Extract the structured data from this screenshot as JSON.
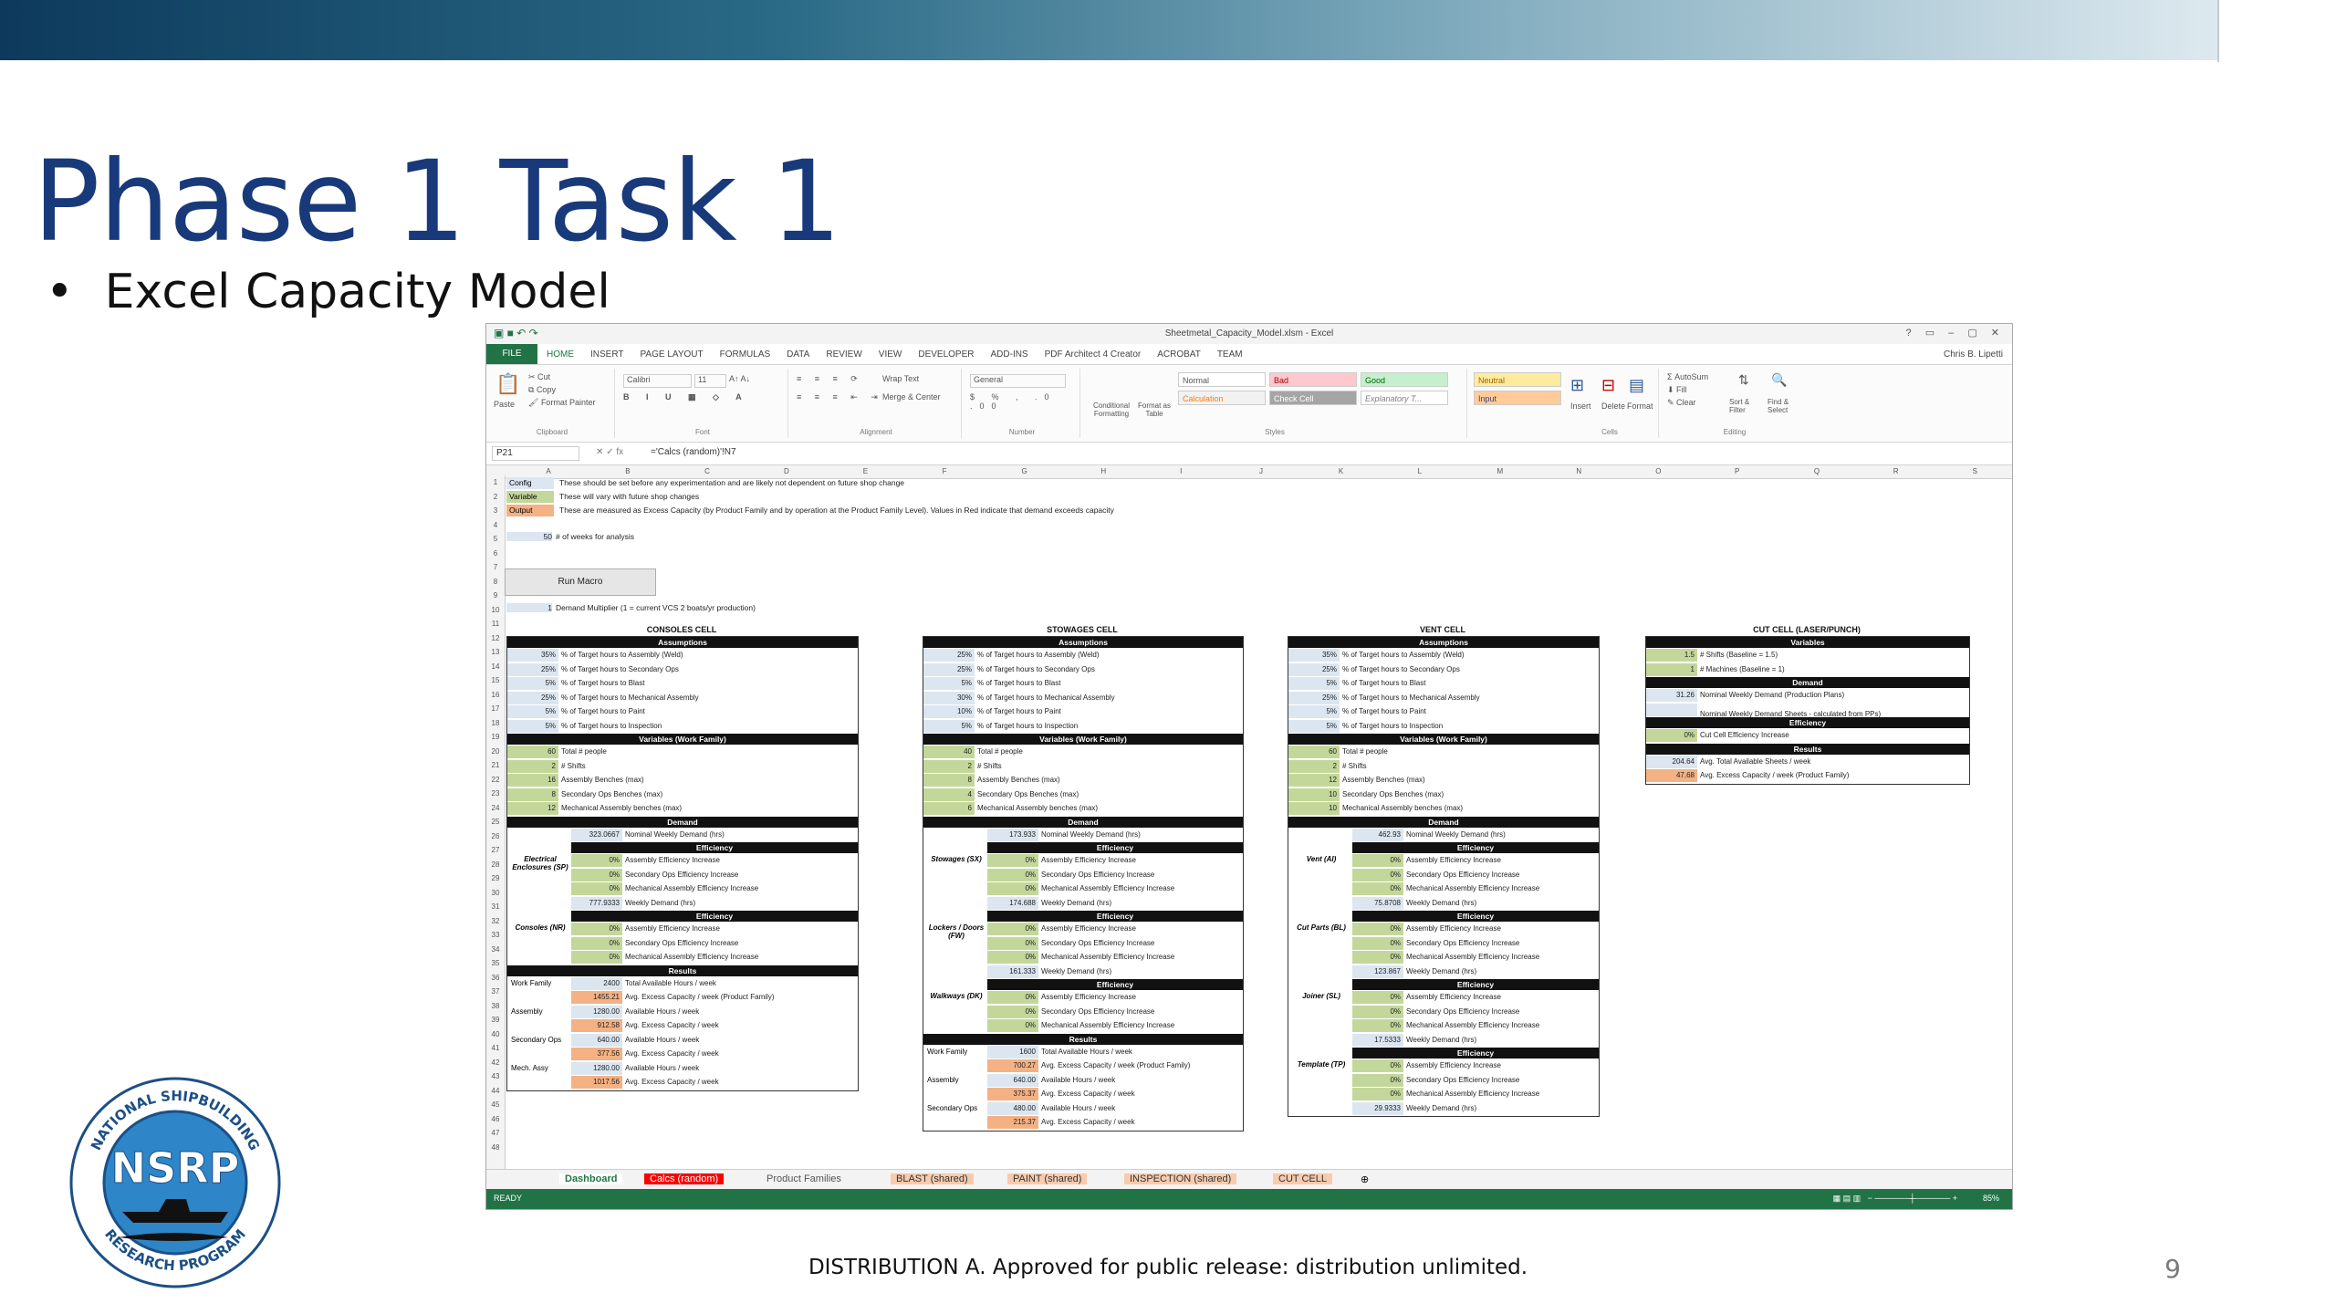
{
  "slide": {
    "title": "Phase 1 Task 1",
    "bullet": "Excel Capacity Model",
    "footer": "DISTRIBUTION A.  Approved for public release: distribution unlimited.",
    "page_number": "9",
    "logo": {
      "text": "NSRP",
      "ring_top": "NATIONAL    SHIPBUILDING",
      "ring_bottom": "RESEARCH    PROGRAM"
    }
  },
  "excel": {
    "window_title": "Sheetmetal_Capacity_Model.xlsm - Excel",
    "ribbon_tabs": [
      "FILE",
      "HOME",
      "INSERT",
      "PAGE LAYOUT",
      "FORMULAS",
      "DATA",
      "REVIEW",
      "VIEW",
      "DEVELOPER",
      "ADD-INS",
      "PDF Architect 4 Creator",
      "ACROBAT",
      "TEAM"
    ],
    "user": "Chris B. Lipetti",
    "clipboard": {
      "paste": "Paste",
      "cut": "Cut",
      "copy": "Copy",
      "format_painter": "Format Painter",
      "caption": "Clipboard"
    },
    "font": {
      "name": "Calibri",
      "size": "11",
      "caption": "Font"
    },
    "alignment": {
      "wrap": "Wrap Text",
      "merge": "Merge & Center",
      "caption": "Alignment"
    },
    "number": {
      "format": "General",
      "caption": "Number"
    },
    "styles": {
      "conditional": "Conditional Formatting",
      "format_table": "Format as Table",
      "normal": "Normal",
      "bad": "Bad",
      "good": "Good",
      "neutral": "Neutral",
      "calculation": "Calculation",
      "check_cell": "Check Cell",
      "explanatory": "Explanatory T...",
      "input": "Input",
      "caption": "Styles"
    },
    "cells": {
      "insert": "Insert",
      "delete": "Delete",
      "format": "Format",
      "caption": "Cells"
    },
    "editing": {
      "autosum": "AutoSum",
      "fill": "Fill",
      "clear": "Clear",
      "sort": "Sort & Filter",
      "find": "Find & Select",
      "caption": "Editing"
    },
    "name_box": "P21",
    "formula": "='Calcs (random)'!N7",
    "columns": [
      "A",
      "B",
      "C",
      "D",
      "E",
      "F",
      "G",
      "H",
      "I",
      "J",
      "K",
      "L",
      "M",
      "N",
      "O",
      "P",
      "Q",
      "R",
      "S"
    ],
    "legend": [
      {
        "tag": "Config",
        "desc": "These should be set before any experimentation and are likely not dependent on future shop change"
      },
      {
        "tag": "Variable",
        "desc": "These will vary with future shop changes"
      },
      {
        "tag": "Output",
        "desc": "These are measured as Excess Capacity (by Product Family and by operation at the Product Family Level).  Values in Red indicate that demand exceeds capacity"
      }
    ],
    "weeks": {
      "value": "50",
      "label": "# of weeks for analysis"
    },
    "run_macro": "Run Macro",
    "demand_multiplier": {
      "value": "1",
      "label": "Demand Multiplier (1 = current VCS 2 boats/yr production)"
    },
    "consoles": {
      "title": "CONSOLES CELL",
      "assumptions": "Assumptions",
      "rows": [
        [
          "35%",
          "% of Target hours to Assembly (Weld)"
        ],
        [
          "25%",
          "% of Target hours to Secondary Ops"
        ],
        [
          "5%",
          "% of Target hours to Blast"
        ],
        [
          "25%",
          "% of Target hours to Mechanical Assembly"
        ],
        [
          "5%",
          "% of Target hours to Paint"
        ],
        [
          "5%",
          "% of Target hours to Inspection"
        ]
      ],
      "variables": "Variables (Work Family)",
      "vrows": [
        [
          "60",
          "Total # people"
        ],
        [
          "2",
          "# Shifts"
        ],
        [
          "16",
          "Assembly Benches (max)"
        ],
        [
          "8",
          "Secondary Ops Benches (max)"
        ],
        [
          "12",
          "Mechanical Assembly benches (max)"
        ]
      ],
      "demand": "Demand",
      "nominal": [
        "323.0667",
        "Nominal Weekly Demand (hrs)"
      ],
      "efficiency": "Efficiency",
      "erows": [
        [
          "0%",
          "Assembly Efficiency Increase"
        ],
        [
          "0%",
          "Secondary Ops Efficiency Increase"
        ],
        [
          "0%",
          "Mechanical Assembly Efficiency Increase"
        ]
      ],
      "family_a": "Electrical Enclosures (SP)",
      "weekly_a": [
        "777.9333",
        "Weekly Demand (hrs)"
      ],
      "efficiency_b": "Efficiency",
      "erows_b": [
        [
          "0%",
          "Assembly Efficiency Increase"
        ],
        [
          "0%",
          "Secondary Ops Efficiency Increase"
        ],
        [
          "0%",
          "Mechanical Assembly Efficiency Increase"
        ]
      ],
      "family_b": "Consoles (NR)",
      "results": "Results",
      "res": [
        [
          "Work Family",
          "2400",
          "Total Available Hours / week"
        ],
        [
          "",
          "1455.21",
          "Avg. Excess Capacity / week (Product Family)"
        ],
        [
          "Assembly",
          "1280.00",
          "Available Hours / week"
        ],
        [
          "",
          "912.58",
          "Avg. Excess Capacity / week"
        ],
        [
          "Secondary Ops",
          "640.00",
          "Available Hours / week"
        ],
        [
          "",
          "377.56",
          "Avg. Excess Capacity / week"
        ],
        [
          "Mech. Assy",
          "1280.00",
          "Available Hours / week"
        ],
        [
          "",
          "1017.56",
          "Avg. Excess Capacity / week"
        ]
      ]
    },
    "stowages": {
      "title": "STOWAGES CELL",
      "assumptions": "Assumptions",
      "rows": [
        [
          "25%",
          "% of Target hours to Assembly (Weld)"
        ],
        [
          "25%",
          "% of Target hours to Secondary Ops"
        ],
        [
          "5%",
          "% of Target hours to Blast"
        ],
        [
          "30%",
          "% of Target hours to Mechanical Assembly"
        ],
        [
          "10%",
          "% of Target hours to Paint"
        ],
        [
          "5%",
          "% of Target hours to Inspection"
        ]
      ],
      "variables": "Variables (Work Family)",
      "vrows": [
        [
          "40",
          "Total # people"
        ],
        [
          "2",
          "# Shifts"
        ],
        [
          "8",
          "Assembly Benches (max)"
        ],
        [
          "4",
          "Secondary Ops Benches (max)"
        ],
        [
          "6",
          "Mechanical Assembly benches (max)"
        ]
      ],
      "demand": "Demand",
      "nominal": [
        "173.933",
        "Nominal Weekly Demand (hrs)"
      ],
      "efficiency": "Efficiency",
      "family_a": "Stowages (SX)",
      "erows": [
        [
          "0%",
          "Assembly Efficiency Increase"
        ],
        [
          "0%",
          "Secondary Ops Efficiency Increase"
        ],
        [
          "0%",
          "Mechanical Assembly Efficiency Increase"
        ]
      ],
      "weekly_a": [
        "174.688",
        "Weekly Demand (hrs)"
      ],
      "family_b": "Lockers / Doors (FW)",
      "erows_b": [
        [
          "0%",
          "Assembly Efficiency Increase"
        ],
        [
          "0%",
          "Secondary Ops Efficiency Increase"
        ],
        [
          "0%",
          "Mechanical Assembly Efficiency Increase"
        ]
      ],
      "weekly_b": [
        "161.333",
        "Weekly Demand (hrs)"
      ],
      "family_c": "Walkways (DK)",
      "erows_c": [
        [
          "0%",
          "Assembly Efficiency Increase"
        ],
        [
          "0%",
          "Secondary Ops Efficiency Increase"
        ],
        [
          "0%",
          "Mechanical Assembly Efficiency Increase"
        ]
      ],
      "results": "Results",
      "res": [
        [
          "Work Family",
          "1600",
          "Total Available Hours / week"
        ],
        [
          "",
          "700.27",
          "Avg. Excess Capacity / week (Product Family)"
        ],
        [
          "Assembly",
          "640.00",
          "Available Hours / week"
        ],
        [
          "",
          "375.37",
          "Avg. Excess Capacity / week"
        ],
        [
          "Secondary Ops",
          "480.00",
          "Available Hours / week"
        ],
        [
          "",
          "215.37",
          "Avg. Excess Capacity / week"
        ]
      ]
    },
    "vent": {
      "title": "VENT CELL",
      "assumptions": "Assumptions",
      "rows": [
        [
          "35%",
          "% of Target hours to Assembly (Weld)"
        ],
        [
          "25%",
          "% of Target hours to Secondary Ops"
        ],
        [
          "5%",
          "% of Target hours to Blast"
        ],
        [
          "25%",
          "% of Target hours to Mechanical Assembly"
        ],
        [
          "5%",
          "% of Target hours to Paint"
        ],
        [
          "5%",
          "% of Target hours to Inspection"
        ]
      ],
      "variables": "Variables (Work Family)",
      "vrows": [
        [
          "60",
          "Total # people"
        ],
        [
          "2",
          "# Shifts"
        ],
        [
          "12",
          "Assembly Benches (max)"
        ],
        [
          "10",
          "Secondary Ops Benches (max)"
        ],
        [
          "10",
          "Mechanical Assembly benches (max)"
        ]
      ],
      "demand": "Demand",
      "nominal": [
        "462.93",
        "Nominal Weekly Demand (hrs)"
      ],
      "efficiency": "Efficiency",
      "family_a": "Vent (AI)",
      "erows": [
        [
          "0%",
          "Assembly Efficiency Increase"
        ],
        [
          "0%",
          "Secondary Ops Efficiency Increase"
        ],
        [
          "0%",
          "Mechanical Assembly Efficiency Increase"
        ]
      ],
      "weekly_a": [
        "75.8708",
        "Weekly Demand (hrs)"
      ],
      "family_b": "Cut Parts (BL)",
      "erows_b": [
        [
          "0%",
          "Assembly Efficiency Increase"
        ],
        [
          "0%",
          "Secondary Ops Efficiency Increase"
        ],
        [
          "0%",
          "Mechanical Assembly Efficiency Increase"
        ]
      ],
      "weekly_b": [
        "123.867",
        "Weekly Demand (hrs)"
      ],
      "family_c": "Joiner (SL)",
      "erows_c": [
        [
          "0%",
          "Assembly Efficiency Increase"
        ],
        [
          "0%",
          "Secondary Ops Efficiency Increase"
        ],
        [
          "0%",
          "Mechanical Assembly Efficiency Increase"
        ]
      ],
      "weekly_c": [
        "17.5333",
        "Weekly Demand (hrs)"
      ],
      "family_d": "Template (TP)",
      "erows_d": [
        [
          "0%",
          "Assembly Efficiency Increase"
        ],
        [
          "0%",
          "Secondary Ops Efficiency Increase"
        ],
        [
          "0%",
          "Mechanical Assembly Efficiency Increase"
        ]
      ],
      "weekly_d": [
        "29.9333",
        "Weekly Demand (hrs)"
      ]
    },
    "cutcell": {
      "title": "CUT CELL (LASER/PUNCH)",
      "variables": "Variables",
      "vrows": [
        [
          "1.5",
          "# Shifts (Baseline = 1.5)"
        ],
        [
          "1",
          "# Machines (Baseline = 1)"
        ]
      ],
      "demand": "Demand",
      "drows": [
        [
          "31.26",
          "Nominal Weekly Demand (Production Plans)"
        ],
        [
          "",
          "Nominal Weekly Demand Sheets - calculated from PPs)"
        ]
      ],
      "efficiency": "Efficiency",
      "erows": [
        [
          "0%",
          "Cut Cell Efficiency Increase"
        ]
      ],
      "results": "Results",
      "res": [
        [
          "204.64",
          "Avg. Total Available Sheets / week"
        ],
        [
          "47.68",
          "Avg. Excess Capacity / week (Product Family)"
        ]
      ]
    },
    "sheet_tabs": [
      "Dashboard",
      "Calcs (random)",
      "Product Families",
      "BLAST (shared)",
      "PAINT (shared)",
      "INSPECTION (shared)",
      "CUT CELL"
    ],
    "status": "READY",
    "zoom": "85%"
  }
}
